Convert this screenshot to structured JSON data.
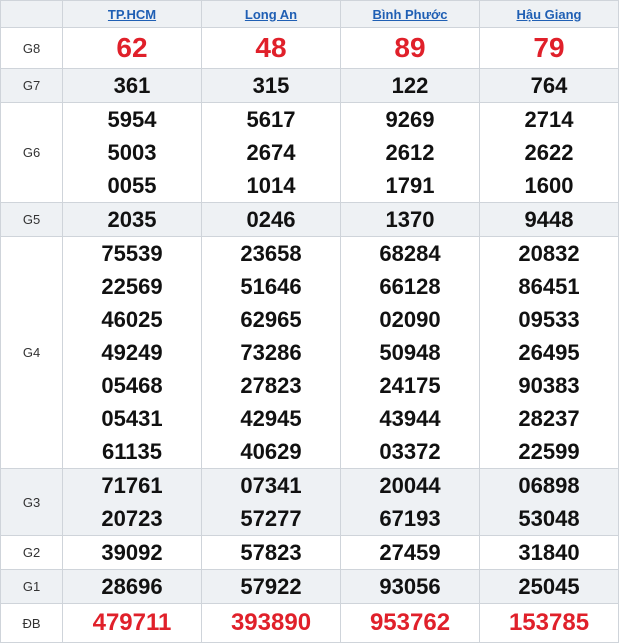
{
  "provinces": [
    {
      "name": "TP.HCM"
    },
    {
      "name": "Long An"
    },
    {
      "name": "Bình Phước"
    },
    {
      "name": "Hậu Giang"
    }
  ],
  "prizes": [
    {
      "label": "G8",
      "shade": false,
      "style": "red-big",
      "values": [
        [
          "62"
        ],
        [
          "48"
        ],
        [
          "89"
        ],
        [
          "79"
        ]
      ]
    },
    {
      "label": "G7",
      "shade": true,
      "style": "normal",
      "values": [
        [
          "361"
        ],
        [
          "315"
        ],
        [
          "122"
        ],
        [
          "764"
        ]
      ]
    },
    {
      "label": "G6",
      "shade": false,
      "style": "normal",
      "values": [
        [
          "5954",
          "5003",
          "0055"
        ],
        [
          "5617",
          "2674",
          "1014"
        ],
        [
          "9269",
          "2612",
          "1791"
        ],
        [
          "2714",
          "2622",
          "1600"
        ]
      ]
    },
    {
      "label": "G5",
      "shade": true,
      "style": "normal",
      "values": [
        [
          "2035"
        ],
        [
          "0246"
        ],
        [
          "1370"
        ],
        [
          "9448"
        ]
      ]
    },
    {
      "label": "G4",
      "shade": false,
      "style": "normal",
      "values": [
        [
          "75539",
          "22569",
          "46025",
          "49249",
          "05468",
          "05431",
          "61135"
        ],
        [
          "23658",
          "51646",
          "62965",
          "73286",
          "27823",
          "42945",
          "40629"
        ],
        [
          "68284",
          "66128",
          "02090",
          "50948",
          "24175",
          "43944",
          "03372"
        ],
        [
          "20832",
          "86451",
          "09533",
          "26495",
          "90383",
          "28237",
          "22599"
        ]
      ]
    },
    {
      "label": "G3",
      "shade": true,
      "style": "normal",
      "values": [
        [
          "71761",
          "20723"
        ],
        [
          "07341",
          "57277"
        ],
        [
          "20044",
          "67193"
        ],
        [
          "06898",
          "53048"
        ]
      ]
    },
    {
      "label": "G2",
      "shade": false,
      "style": "normal",
      "values": [
        [
          "39092"
        ],
        [
          "57823"
        ],
        [
          "27459"
        ],
        [
          "31840"
        ]
      ]
    },
    {
      "label": "G1",
      "shade": true,
      "style": "normal",
      "values": [
        [
          "28696"
        ],
        [
          "57922"
        ],
        [
          "93056"
        ],
        [
          "25045"
        ]
      ]
    },
    {
      "label": "ĐB",
      "shade": false,
      "style": "red-db",
      "values": [
        [
          "479711"
        ],
        [
          "393890"
        ],
        [
          "953762"
        ],
        [
          "153785"
        ]
      ]
    }
  ],
  "colors": {
    "link": "#1f5fb4",
    "special": "#e0202a",
    "shade": "#eef1f4",
    "border": "#cfd4da"
  }
}
